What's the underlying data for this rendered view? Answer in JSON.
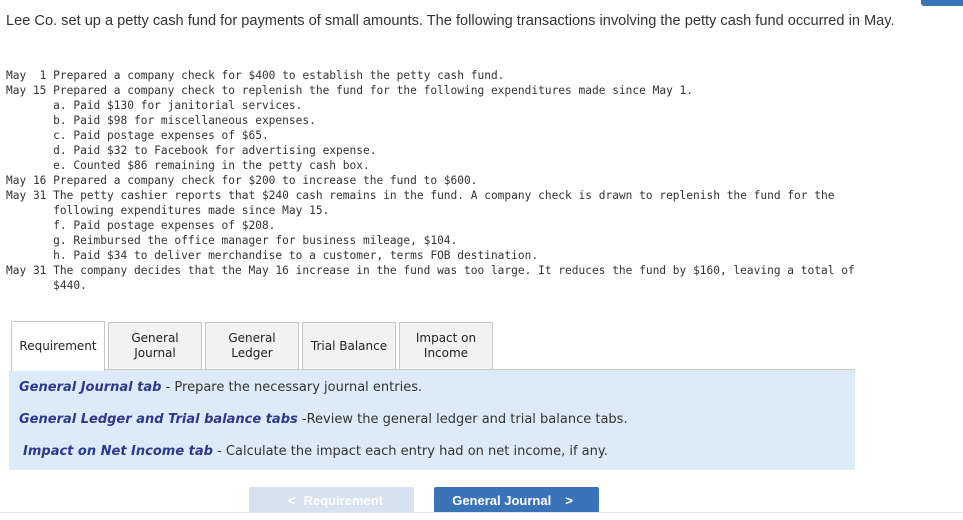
{
  "intro": "Lee Co. set up a petty cash fund for payments of small amounts. The following transactions involving the petty cash fund occurred in May.",
  "transactions": [
    "May  1 Prepared a company check for $400 to establish the petty cash fund.",
    "May 15 Prepared a company check to replenish the fund for the following expenditures made since May 1.",
    "       a. Paid $130 for janitorial services.",
    "       b. Paid $98 for miscellaneous expenses.",
    "       c. Paid postage expenses of $65.",
    "       d. Paid $32 to Facebook for advertising expense.",
    "       e. Counted $86 remaining in the petty cash box.",
    "May 16 Prepared a company check for $200 to increase the fund to $600.",
    "May 31 The petty cashier reports that $240 cash remains in the fund. A company check is drawn to replenish the fund for the",
    "       following expenditures made since May 15.",
    "       f. Paid postage expenses of $208.",
    "       g. Reimbursed the office manager for business mileage, $104.",
    "       h. Paid $34 to deliver merchandise to a customer, terms FOB destination.",
    "May 31 The company decides that the May 16 increase in the fund was too large. It reduces the fund by $160, leaving a total of",
    "       $440."
  ],
  "tabs": [
    {
      "label": "Requirement",
      "active": true
    },
    {
      "label": "General\nJournal",
      "line1": "General",
      "line2": "Journal"
    },
    {
      "label": "General\nLedger",
      "line1": "General",
      "line2": "Ledger"
    },
    {
      "label": "Trial Balance"
    },
    {
      "label": "Impact on\nIncome",
      "line1": "Impact on",
      "line2": "Income"
    }
  ],
  "panel": {
    "rows": [
      {
        "em": "General Journal tab",
        "text": " - Prepare the necessary journal entries."
      },
      {
        "em": "General Ledger and Trial balance tabs",
        "text": " -Review the general ledger and trial balance tabs."
      },
      {
        "em": "Impact on Net Income tab",
        "text": " - Calculate the impact each entry had on net income, if any."
      }
    ]
  },
  "nav": {
    "prev_label": "Requirement",
    "next_label": "General Journal",
    "prev_icon": "<",
    "next_icon": ">"
  },
  "colors": {
    "accent": "#3b73b9",
    "panel_bg": "#dcebf7",
    "emphasis": "#2b3a8c",
    "disabled_button": "#d6e2f0"
  }
}
